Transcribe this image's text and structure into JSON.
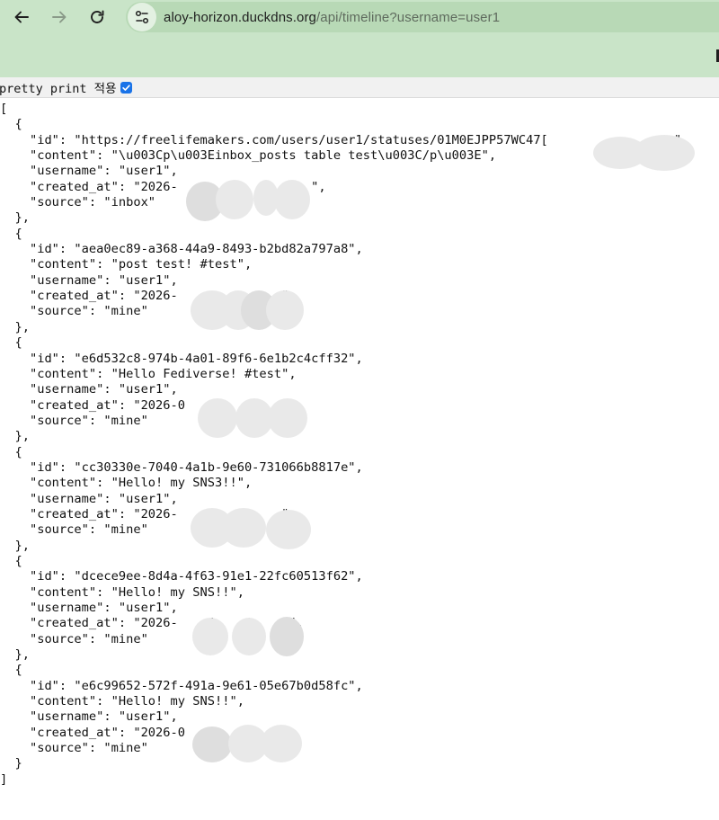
{
  "browser": {
    "url_host": "aloy-horizon.duckdns.org",
    "url_path": "/api/timeline?username=user1"
  },
  "page": {
    "pretty_print_label": "pretty print 적용",
    "pretty_print_checked": true,
    "json_lines": [
      "[",
      "  {",
      "    \"id\": \"https://freelifemakers.com/users/user1/statuses/01M0EJPP57WC47[                 \",",
      "    \"content\": \"\\u003Cp\\u003Einbox_posts table test\\u003C/p\\u003E\",",
      "    \"username\": \"user1\",",
      "    \"created_at\": \"2026-           3      \",",
      "    \"source\": \"inbox\"",
      "  },",
      "  {",
      "    \"id\": \"aea0ec89-a368-44a9-8493-b2bd82a797a8\",",
      "    \"content\": \"post test! #test\",",
      "    \"username\": \"user1\",",
      "    \"created_at\": \"2026-              \",",
      "    \"source\": \"mine\"",
      "  },",
      "  {",
      "    \"id\": \"e6d532c8-974b-4a01-89f6-6e1b2c4cff32\",",
      "    \"content\": \"Hello Fediverse! #test\",",
      "    \"username\": \"user1\",",
      "    \"created_at\": \"2026-0             \",",
      "    \"source\": \"mine\"",
      "  },",
      "  {",
      "    \"id\": \"cc30330e-7040-4a1b-9e60-731066b8817e\",",
      "    \"content\": \"Hello! my SNS3!!\",",
      "    \"username\": \"user1\",",
      "    \"created_at\": \"2026-              \",",
      "    \"source\": \"mine\"",
      "  },",
      "  {",
      "    \"id\": \"dcece9ee-8d4a-4f63-91e1-22fc60513f62\",",
      "    \"content\": \"Hello! my SNS!!\",",
      "    \"username\": \"user1\",",
      "    \"created_at\": \"2026-    4    (    3\",",
      "    \"source\": \"mine\"",
      "  },",
      "  {",
      "    \"id\": \"e6c99652-572f-491a-9e61-05e67b0d58fc\",",
      "    \"content\": \"Hello! my SNS!!\",",
      "    \"username\": \"user1\",",
      "    \"created_at\": \"2026-0             \",",
      "    \"source\": \"mine\"",
      "  }",
      "]"
    ]
  }
}
